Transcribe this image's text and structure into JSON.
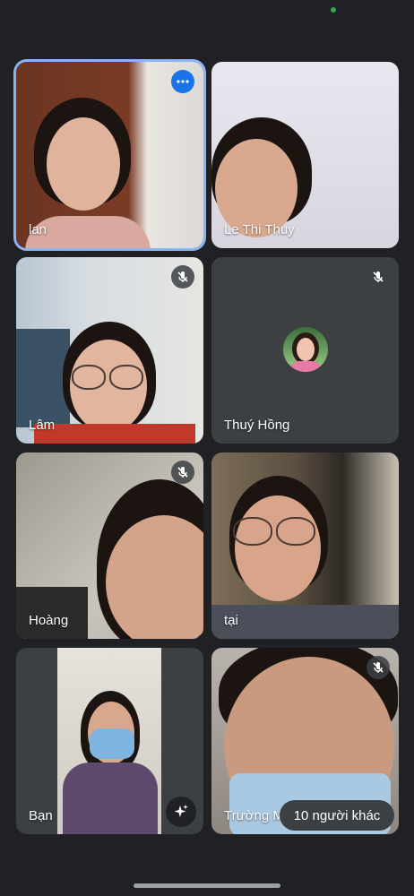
{
  "participants": [
    {
      "name": "lan",
      "muted": false,
      "active": true
    },
    {
      "name": "Le Thi Thuy",
      "muted": false
    },
    {
      "name": "Lâm",
      "muted": true
    },
    {
      "name": "Thuý Hồng",
      "muted": true
    },
    {
      "name": "Hoàng",
      "muted": true
    },
    {
      "name": "tại",
      "muted": false
    },
    {
      "name": "Bạn",
      "muted": false
    },
    {
      "name": "Trường M",
      "muted": true
    }
  ],
  "more_participants_label": "10 người khác",
  "icons": {
    "more": "more-options-icon",
    "mic_off": "mic-off-icon",
    "effects": "sparkle-effects-icon"
  },
  "colors": {
    "background": "#202124",
    "active_border": "#8ab4f8",
    "accent": "#1a73e8"
  }
}
